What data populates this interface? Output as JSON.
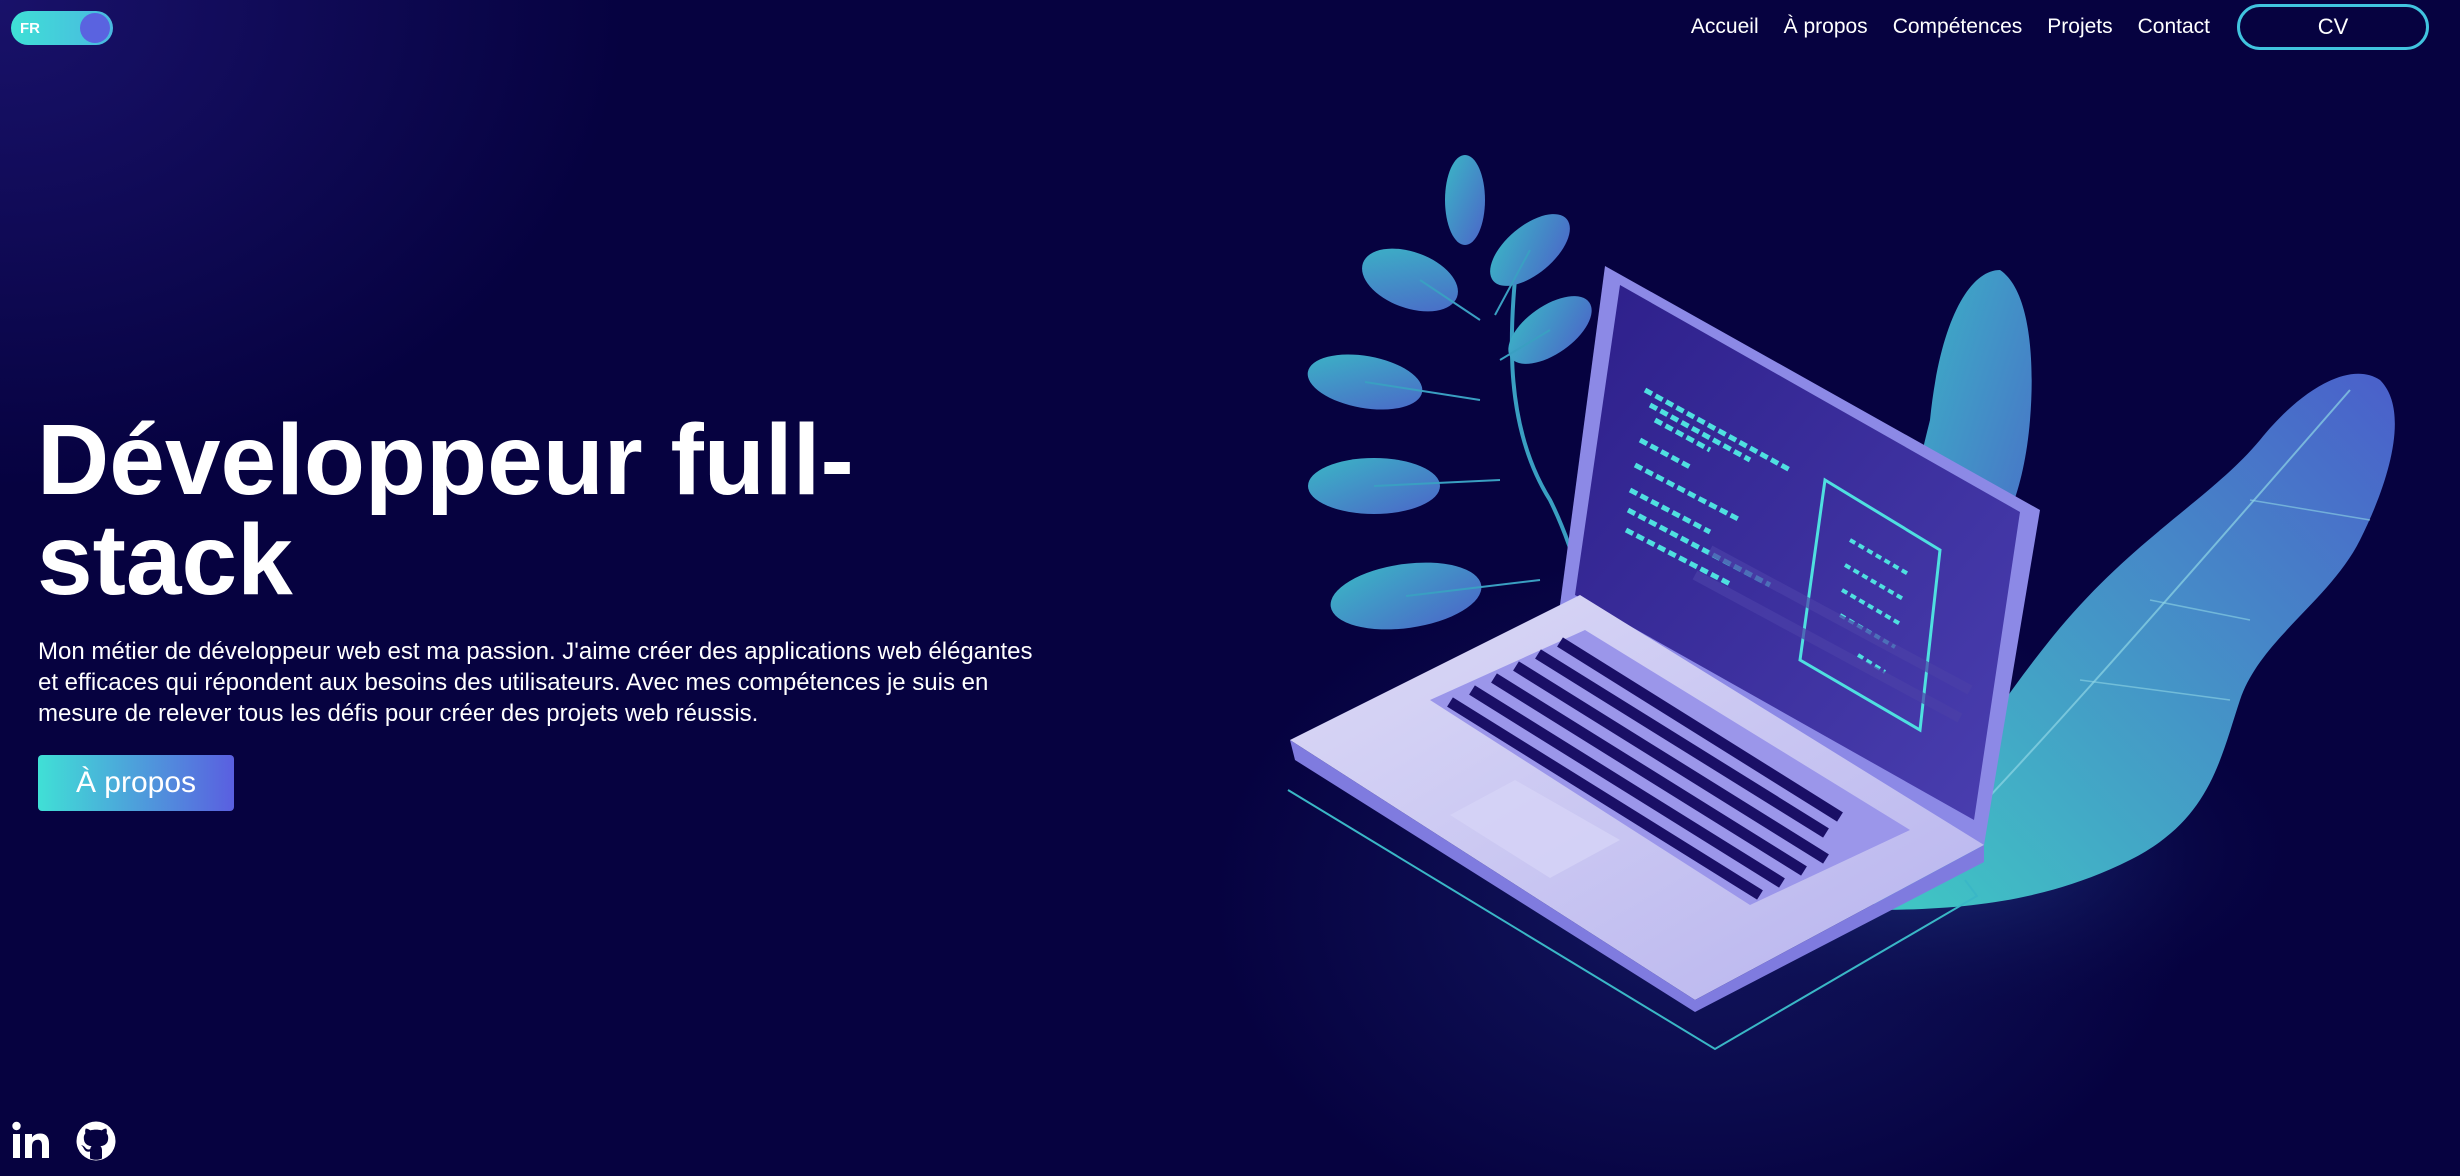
{
  "lang_toggle": {
    "label": "FR"
  },
  "nav": {
    "items": [
      {
        "label": "Accueil"
      },
      {
        "label": "À propos"
      },
      {
        "label": "Compétences"
      },
      {
        "label": "Projets"
      },
      {
        "label": "Contact"
      }
    ],
    "cv_label": "CV"
  },
  "hero": {
    "title_line1": "Développeur full-",
    "title_line2": "stack",
    "text": "Mon métier de développeur web est ma passion. J'aime créer des applications web élégantes et efficaces qui répondent aux besoins des utilisateurs. Avec mes compétences je suis en mesure de relever tous les défis pour créer des projets web réussis.",
    "button_label": "À propos"
  },
  "social": {
    "icons": [
      "linkedin-icon",
      "github-icon"
    ]
  },
  "colors": {
    "background": "#060240",
    "accent_teal": "#40e0d6",
    "accent_blue": "#5a5fe0",
    "cv_border": "#41c4df"
  }
}
